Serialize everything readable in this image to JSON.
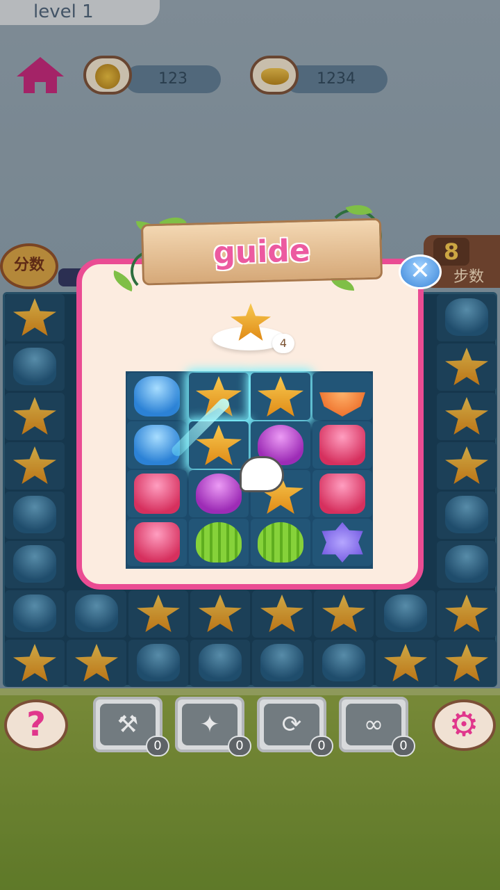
{
  "level_label": "level 1",
  "resources": {
    "coins": "123",
    "gold": "1234"
  },
  "hud": {
    "score_label": "分数",
    "moves_value": "8",
    "moves_label": "步数"
  },
  "guide": {
    "title": "guide",
    "close_symbol": "✕",
    "target_count": "4",
    "target_gem": "yellow-star-jelly"
  },
  "demo_board": {
    "rows": [
      [
        "blue-flower",
        "yellow-star",
        "yellow-star",
        "orange-slice"
      ],
      [
        "blue-flower",
        "yellow-star",
        "purple-drop",
        "pink-square"
      ],
      [
        "pink-square",
        "purple-drop",
        "yellow-star",
        "pink-square"
      ],
      [
        "pink-square",
        "green-melon",
        "green-melon",
        "violet-flower"
      ]
    ],
    "highlighted": [
      [
        0,
        1
      ],
      [
        0,
        2
      ],
      [
        1,
        1
      ]
    ]
  },
  "boosters": [
    {
      "name": "hammer",
      "icon": "⚒",
      "count": "0"
    },
    {
      "name": "magic-wand",
      "icon": "✦",
      "count": "0"
    },
    {
      "name": "shuffle",
      "icon": "⟳",
      "count": "0"
    },
    {
      "name": "infinite-moves",
      "icon": "∞",
      "count": "0"
    }
  ],
  "buttons": {
    "help_symbol": "?",
    "settings_symbol": "⚙"
  },
  "colors": {
    "panel_border": "#ea4c93",
    "title_pink": "#ec5aa0",
    "board_bg": "#173f58"
  }
}
